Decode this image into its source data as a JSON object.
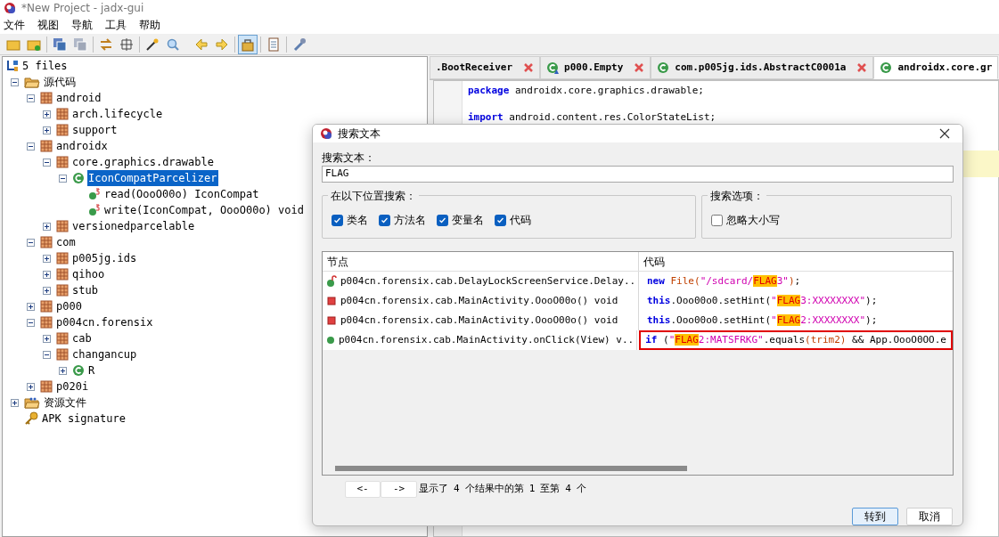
{
  "window": {
    "title": "*New Project - jadx-gui"
  },
  "menu": [
    "文件",
    "视图",
    "导航",
    "工具",
    "帮助"
  ],
  "toolbar": {
    "sync_pressed": true
  },
  "tree": {
    "root": "5 files",
    "children": [
      {
        "label": "源代码",
        "kind": "folder",
        "expanded": true,
        "selected": false,
        "children": [
          {
            "label": "android",
            "kind": "package",
            "expanded": true,
            "selected": false,
            "children": [
              {
                "label": "arch.lifecycle",
                "kind": "package",
                "expanded": false,
                "selected": false
              },
              {
                "label": "support",
                "kind": "package",
                "expanded": false,
                "selected": false
              }
            ]
          },
          {
            "label": "androidx",
            "kind": "package",
            "expanded": true,
            "selected": false,
            "children": [
              {
                "label": "core.graphics.drawable",
                "kind": "package",
                "expanded": true,
                "selected": false,
                "children": [
                  {
                    "label": "IconCompatParcelizer",
                    "kind": "class",
                    "expanded": true,
                    "selected": true,
                    "children": [
                      {
                        "label": "read(OooO00o) IconCompat",
                        "kind": "method",
                        "selected": false
                      },
                      {
                        "label": "write(IconCompat, OooO00o) void",
                        "kind": "method",
                        "selected": false
                      }
                    ]
                  }
                ]
              },
              {
                "label": "versionedparcelable",
                "kind": "package",
                "expanded": false,
                "selected": false
              }
            ]
          },
          {
            "label": "com",
            "kind": "package",
            "expanded": true,
            "selected": false,
            "children": [
              {
                "label": "p005jg.ids",
                "kind": "package",
                "expanded": false,
                "selected": false
              },
              {
                "label": "qihoo",
                "kind": "package",
                "expanded": false,
                "selected": false
              },
              {
                "label": "stub",
                "kind": "package",
                "expanded": false,
                "selected": false
              }
            ]
          },
          {
            "label": "p000",
            "kind": "package",
            "expanded": false,
            "selected": false
          },
          {
            "label": "p004cn.forensix",
            "kind": "package",
            "expanded": true,
            "selected": false,
            "children": [
              {
                "label": "cab",
                "kind": "package",
                "expanded": false,
                "selected": false
              },
              {
                "label": "changancup",
                "kind": "package",
                "expanded": true,
                "selected": false,
                "children": [
                  {
                    "label": "R",
                    "kind": "class",
                    "expanded": false,
                    "selected": false
                  }
                ]
              }
            ]
          },
          {
            "label": "p020i",
            "kind": "package",
            "expanded": false,
            "selected": false
          }
        ]
      },
      {
        "label": "资源文件",
        "kind": "resources",
        "expanded": false,
        "selected": false
      },
      {
        "label": "APK signature",
        "kind": "key",
        "selected": false
      }
    ]
  },
  "editor_tabs": [
    {
      "label": ".BootReceiver",
      "kind": "none",
      "selected": false,
      "closable": true
    },
    {
      "label": "p000.Empty",
      "kind": "class-warning",
      "selected": false,
      "closable": true
    },
    {
      "label": "com.p005jg.ids.AbstractC0001a",
      "kind": "class",
      "selected": false,
      "closable": true
    },
    {
      "label": "androidx.core.gr",
      "kind": "class",
      "selected": true,
      "closable": false
    }
  ],
  "code": [
    [
      {
        "kind": "keyword",
        "text": "package"
      },
      {
        "kind": "plain",
        "text": " androidx.core.graphics.drawable;"
      }
    ],
    [
      {
        "kind": "keyword",
        "text": "import"
      },
      {
        "kind": "plain",
        "text": " android.content.res.ColorStateList;"
      }
    ]
  ],
  "dialog": {
    "title": "搜索文本",
    "search_label": "搜索文本：",
    "search_value": "FLAG",
    "scope_group": "在以下位置搜索：",
    "scope": [
      {
        "label": "类名",
        "checked": true
      },
      {
        "label": "方法名",
        "checked": true
      },
      {
        "label": "变量名",
        "checked": true
      },
      {
        "label": "代码",
        "checked": true
      }
    ],
    "options_group": "搜索选项：",
    "options": [
      {
        "label": "忽略大小写",
        "checked": false
      }
    ],
    "columns": [
      "节点",
      "代码"
    ],
    "results": [
      {
        "node": "p004cn.forensix.cab.DelayLockScreenService.Delay..",
        "kind": "field",
        "boxed": false,
        "code": [
          {
            "kind": "keyword",
            "text": "new"
          },
          {
            "kind": "call",
            "text": " File("
          },
          {
            "kind": "string",
            "text": "\"/sdcard/"
          },
          {
            "kind": "match",
            "text": "FLAG"
          },
          {
            "kind": "string",
            "text": "3\""
          },
          {
            "kind": "call",
            "text": ")"
          },
          {
            "kind": "plain",
            "text": ";"
          }
        ]
      },
      {
        "node": "p004cn.forensix.cab.MainActivity.OooO00o() void",
        "kind": "private-method",
        "boxed": false,
        "code": [
          {
            "kind": "keyword",
            "text": "this"
          },
          {
            "kind": "plain",
            "text": ".Ooo00o0.setHint("
          },
          {
            "kind": "string",
            "text": "\""
          },
          {
            "kind": "match",
            "text": "FLAG"
          },
          {
            "kind": "string",
            "text": "3:XXXXXXXX\""
          },
          {
            "kind": "plain",
            "text": ");"
          }
        ]
      },
      {
        "node": "p004cn.forensix.cab.MainActivity.OooO00o() void",
        "kind": "private-method",
        "boxed": false,
        "code": [
          {
            "kind": "keyword",
            "text": "this"
          },
          {
            "kind": "plain",
            "text": ".Ooo00o0.setHint("
          },
          {
            "kind": "string",
            "text": "\""
          },
          {
            "kind": "match",
            "text": "FLAG"
          },
          {
            "kind": "string",
            "text": "2:XXXXXXXX\""
          },
          {
            "kind": "plain",
            "text": ");"
          }
        ]
      },
      {
        "node": "p004cn.forensix.cab.MainActivity.onClick(View) v..",
        "kind": "public-method",
        "boxed": true,
        "code": [
          {
            "kind": "keyword",
            "text": "if"
          },
          {
            "kind": "plain",
            "text": " ("
          },
          {
            "kind": "string",
            "text": "\""
          },
          {
            "kind": "match",
            "text": "FLAG"
          },
          {
            "kind": "string",
            "text": "2:MATSFRKG\""
          },
          {
            "kind": "plain",
            "text": ".equals"
          },
          {
            "kind": "call",
            "text": "(trim2)"
          },
          {
            "kind": "plain",
            "text": " && App.OooO0OO.e"
          }
        ]
      }
    ],
    "prev_button": "<-",
    "next_button": "->",
    "status": [
      "显示了",
      "4",
      "个结果中的第",
      "1",
      "至第",
      "4",
      "个"
    ],
    "ok_button": "转到",
    "cancel_button": "取消"
  }
}
